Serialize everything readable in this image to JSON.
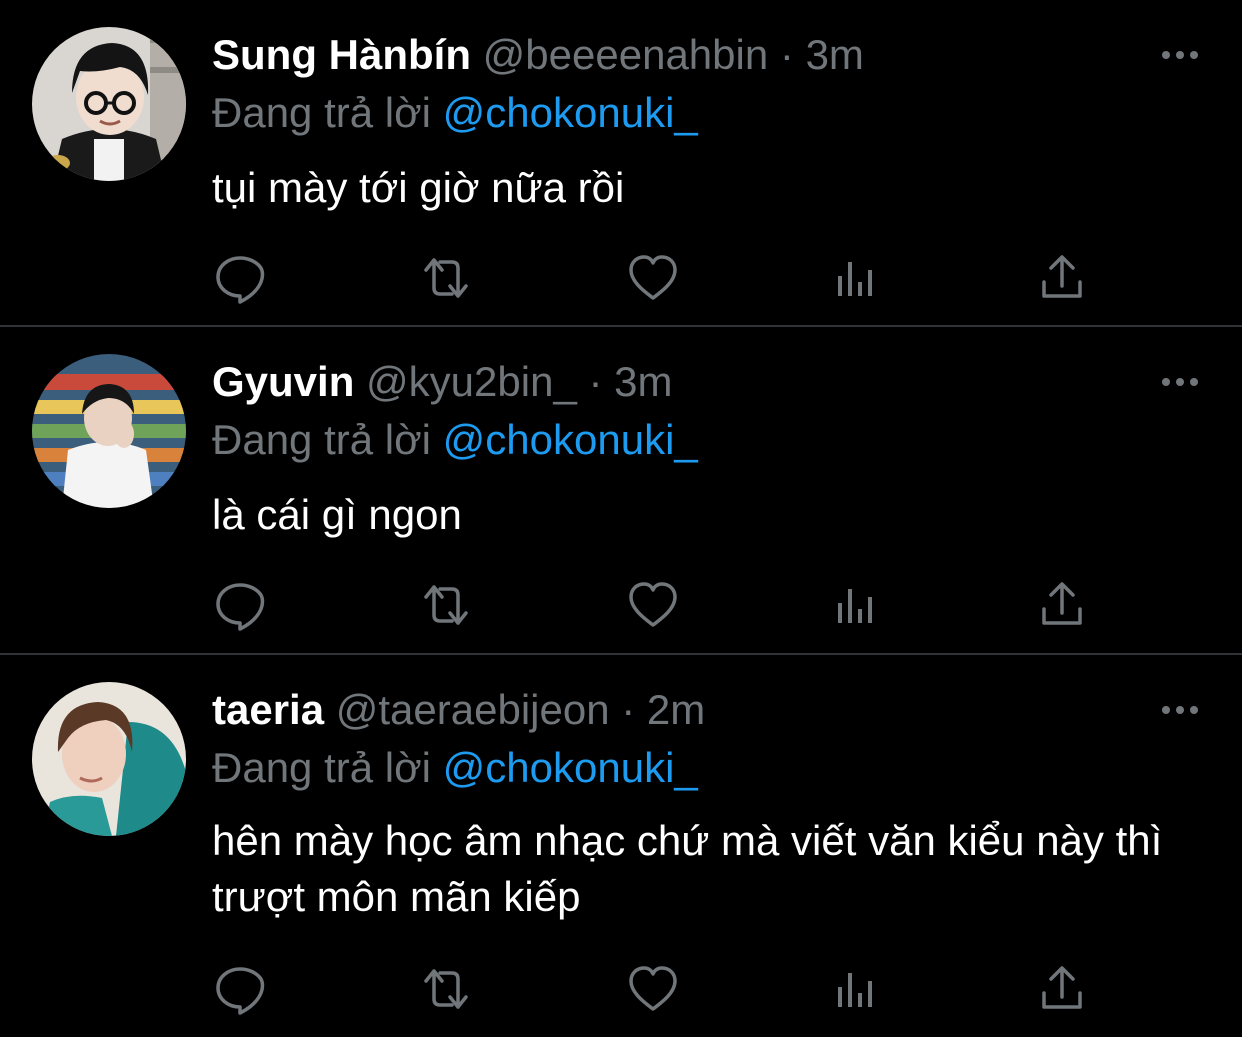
{
  "tweets": [
    {
      "display_name": "Sung Hànbín",
      "handle": "@beeeenahbin",
      "separator": "·",
      "time": "3m",
      "reply_prefix": "Đang trả lời",
      "reply_to": "@chokonuki_",
      "text": "tụi mày tới giờ nữa rồi",
      "avatar": "profile-photo-boy-glasses"
    },
    {
      "display_name": "Gyuvin",
      "handle": "@kyu2bin_",
      "separator": "·",
      "time": "3m",
      "reply_prefix": "Đang trả lời",
      "reply_to": "@chokonuki_",
      "text": "là cái gì ngon",
      "avatar": "profile-photo-store"
    },
    {
      "display_name": "taeria",
      "handle": "@taeraebijeon",
      "separator": "·",
      "time": "2m",
      "reply_prefix": "Đang trả lời",
      "reply_to": "@chokonuki_",
      "text": "hên mày học âm nhạc chứ mà viết văn kiểu này thì trượt môn mãn kiếp",
      "avatar": "profile-photo-teal-hoodie"
    }
  ],
  "icons": {
    "more": "more-dots-icon",
    "reply": "reply-icon",
    "retweet": "retweet-icon",
    "like": "like-heart-icon",
    "views": "views-chart-icon",
    "share": "share-icon"
  },
  "colors": {
    "background": "#000000",
    "text": "#ffffff",
    "muted": "#71767b",
    "link": "#1d9bf0",
    "divider": "#2f3336"
  }
}
